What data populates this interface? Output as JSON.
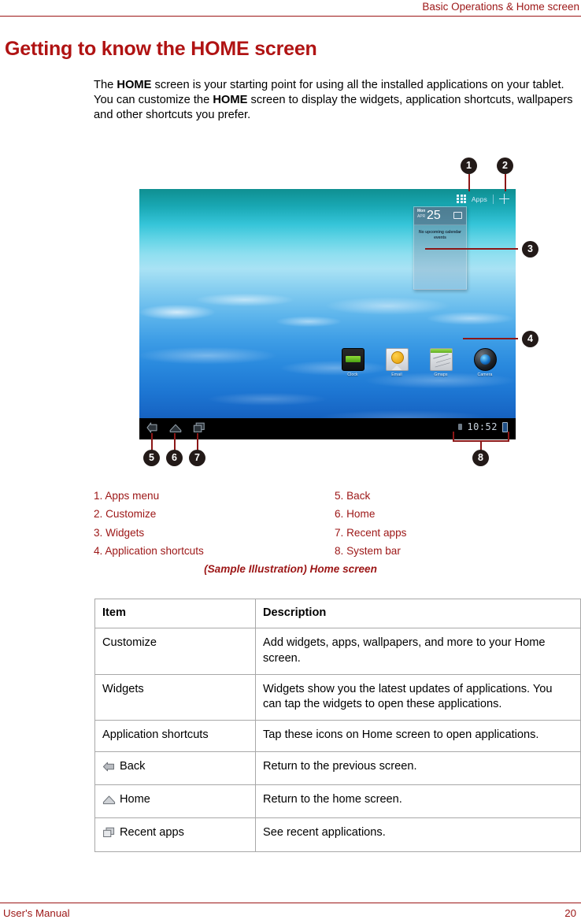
{
  "header": {
    "running_head": "Basic Operations & Home screen"
  },
  "title": "Getting to know the HOME screen",
  "intro": {
    "part1": "The ",
    "bold1": "HOME",
    "part2": " screen is your starting point for using all the installed applications on your tablet. You can customize the ",
    "bold2": "HOME",
    "part3": " screen to display the widgets, application shortcuts, wallpapers and other shortcuts you prefer."
  },
  "illustration": {
    "apps_bar": {
      "apps_label": "Apps",
      "plus_label": "+"
    },
    "calendar_widget": {
      "day_of_week": "Mon",
      "month": "APR",
      "day": "25",
      "body": "No upcoming calendar events"
    },
    "shortcuts": [
      {
        "label": "Clock",
        "icon": "clock-icon"
      },
      {
        "label": "Email",
        "icon": "email-icon"
      },
      {
        "label": "Gmaps",
        "icon": "maps-icon"
      },
      {
        "label": "Camera",
        "icon": "camera-icon"
      }
    ],
    "system_bar": {
      "back": "back-icon",
      "home": "home-icon",
      "recent": "recent-apps-icon",
      "clock": "10:52"
    },
    "callouts": [
      "1",
      "2",
      "3",
      "4",
      "5",
      "6",
      "7",
      "8"
    ]
  },
  "legend": {
    "left": [
      "1. Apps menu",
      "2. Customize",
      "3. Widgets",
      "4. Application shortcuts"
    ],
    "right": [
      "5. Back",
      "6. Home",
      "7. Recent apps",
      "8. System bar"
    ]
  },
  "caption": "(Sample Illustration) Home screen",
  "table": {
    "headers": [
      "Item",
      "Description"
    ],
    "rows": [
      {
        "icon": null,
        "item": "Customize",
        "description": "Add widgets, apps, wallpapers, and more to your Home screen."
      },
      {
        "icon": null,
        "item": "Widgets",
        "description": "Widgets show you the latest updates of applications. You can tap the widgets to open these applications."
      },
      {
        "icon": null,
        "item": "Application shortcuts",
        "description": "Tap these icons on Home screen to open applications."
      },
      {
        "icon": "back-icon",
        "item": "Back",
        "description": "Return to the previous screen."
      },
      {
        "icon": "home-icon",
        "item": "Home",
        "description": "Return to the home screen."
      },
      {
        "icon": "recent-apps-icon",
        "item": "Recent apps",
        "description": "See recent applications."
      }
    ]
  },
  "footer": {
    "left": "User's Manual",
    "page": "20"
  }
}
